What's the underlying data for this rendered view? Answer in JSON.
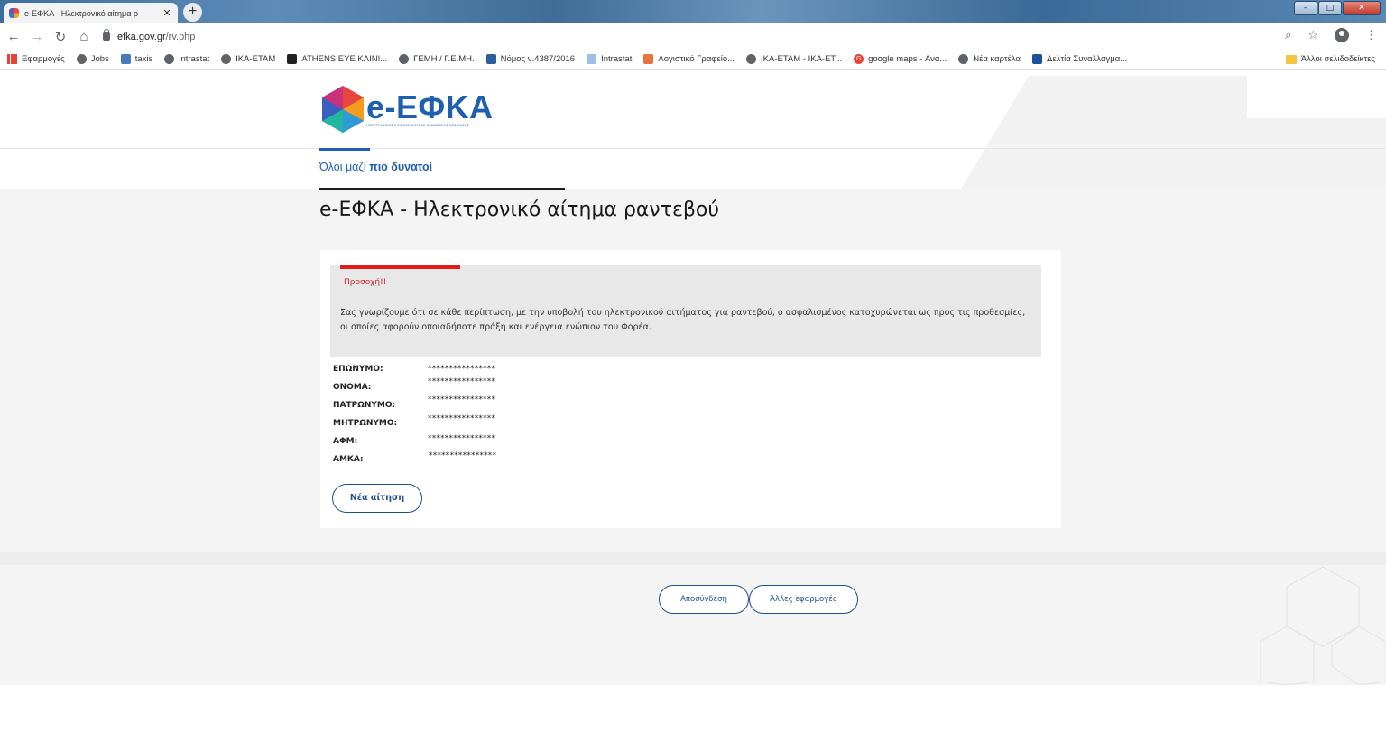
{
  "browser": {
    "tab_title": "e-ΕΦΚΑ - Ηλεκτρονικό αίτημα ρ",
    "new_tab": "+",
    "url_domain": "efka.gov.gr",
    "url_path": "/rv.php",
    "bookmarks": [
      {
        "label": "Εφαρμογές"
      },
      {
        "label": "Jobs"
      },
      {
        "label": "taxis"
      },
      {
        "label": "intrastat"
      },
      {
        "label": "ΙΚΑ-ΕΤΑΜ"
      },
      {
        "label": "ATHENS EYE ΚΛΙΝΙ..."
      },
      {
        "label": "ΓΕΜΗ / Γ.Ε.ΜΗ."
      },
      {
        "label": "Νόμος ν.4387/2016"
      },
      {
        "label": "Intrastat"
      },
      {
        "label": "Λογιστικό Γραφείο..."
      },
      {
        "label": "ΙΚΑ-ΕΤΑΜ - ΙΚΑ-ΕΤ..."
      },
      {
        "label": "google maps - Ανα..."
      },
      {
        "label": "Νέα καρτέλα"
      },
      {
        "label": "Δελτία Συναλλαγμα..."
      }
    ],
    "other_bookmarks": "Άλλοι σελιδοδείκτες"
  },
  "header": {
    "logo_text": "e-ΕΦΚΑ",
    "logo_subtitle": "ΗΛΕΚΤΡΟΝΙΚΟΣ ΕΘΝΙΚΟΣ ΦΟΡΕΑΣ ΚΟΙΝΩΝΙΚΗΣ ΑΣΦΑΛΙΣΗΣ",
    "tagline_regular": "Όλοι μαζί ",
    "tagline_bold": "πιο δυνατοί"
  },
  "main": {
    "page_title": "e-ΕΦΚΑ - Ηλεκτρονικό αίτημα ραντεβού",
    "notice_title": "Προσοχή!!",
    "notice_text": "Σας γνωρίζουμε ότι σε κάθε περίπτωση, με την υποβολή του ηλεκτρονικού αιτήματος για ραντεβού, ο ασφαλισμένος κατοχυρώνεται ως προς τις προθεσμίες, οι οποίες αφορούν οποιαδήποτε πράξη και ενέργεια ενώπιον του Φορέα.",
    "fields": [
      {
        "label": "ΕΠΩΝΥΜΟ:",
        "value": "****************"
      },
      {
        "label": "ΟΝΟΜΑ:",
        "value": "****************"
      },
      {
        "label": "ΠΑΤΡΩΝΥΜΟ:",
        "value": "****************"
      },
      {
        "label": "ΜΗΤΡΩΝΥΜΟ:",
        "value": "****************"
      },
      {
        "label": "ΑΦΜ:",
        "value": "****************"
      },
      {
        "label": "ΑΜΚΑ:",
        "value": "****************"
      }
    ],
    "new_request_button": "Νέα αίτηση"
  },
  "footer": {
    "logout_button": "Αποσύνδεση",
    "other_apps_button": "Άλλες εφαρμογές"
  },
  "colors": {
    "brand_blue": "#1f5fb0",
    "alert_red": "#e21b1b",
    "button_border": "#1f4f8f"
  }
}
